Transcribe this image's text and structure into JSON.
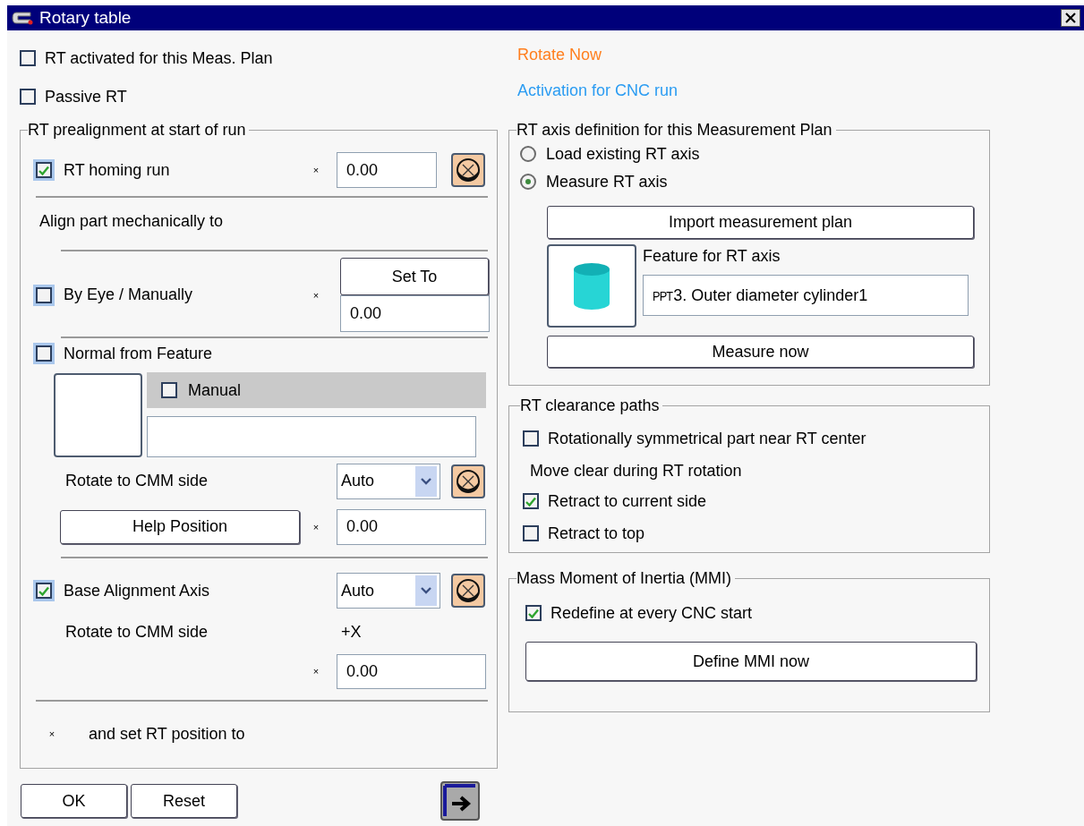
{
  "window": {
    "title": "Rotary table"
  },
  "options": [
    {
      "label": "RT activated for this Meas. Plan",
      "checked": false
    },
    {
      "label": "Passive RT",
      "checked": false
    }
  ],
  "links": [
    {
      "label": "Rotate Now",
      "color": "#ff7f1e"
    },
    {
      "label": "Activation for CNC run",
      "color": "#2b9cf2"
    }
  ],
  "prealignment": {
    "title": "RT prealignment at start of run",
    "homing": {
      "label": "RT homing run",
      "checked": true,
      "mark": "×",
      "value": "0.00"
    },
    "align_label": "Align part mechanically to",
    "by_eye": {
      "label": "By Eye / Manually",
      "checked": false,
      "button": "Set To",
      "mark": "×",
      "value": "0.00"
    },
    "normal": {
      "label": "Normal from Feature",
      "checked": false,
      "manual": {
        "label": "Manual",
        "checked": false
      },
      "rotate_label": "Rotate to CMM side",
      "select": "Auto",
      "help_button": "Help Position",
      "mark": "×",
      "value": "0.00"
    },
    "base": {
      "label": "Base Alignment Axis",
      "checked": true,
      "select": "Auto",
      "rotate_label": "Rotate to CMM side",
      "side": "+X",
      "mark": "×",
      "value": "0.00"
    },
    "footer_mark": "×",
    "footer_label": "and set RT position to"
  },
  "axis_definition": {
    "title": "RT axis definition for this Measurement Plan",
    "options": [
      {
        "label": "Load existing RT axis",
        "selected": false
      },
      {
        "label": "Measure RT axis",
        "selected": true
      }
    ],
    "import_button": "Import measurement plan",
    "feature_label": "Feature for RT axis",
    "feature_prefix": "PPT",
    "feature_value": "3. Outer diameter cylinder1",
    "measure_button": "Measure now"
  },
  "clearance": {
    "title": "RT clearance paths",
    "symmetric": {
      "label": "Rotationally symmetrical part near RT center",
      "checked": false
    },
    "move_label": "Move clear during RT rotation",
    "retract": [
      {
        "label": "Retract to current side",
        "checked": true
      },
      {
        "label": "Retract to top",
        "checked": false
      }
    ]
  },
  "mmi": {
    "title": "Mass Moment of Inertia (MMI)",
    "redefine": {
      "label": "Redefine at every CNC start",
      "checked": true
    },
    "button": "Define MMI now"
  },
  "buttons": [
    {
      "label": "OK"
    },
    {
      "label": "Reset"
    }
  ]
}
